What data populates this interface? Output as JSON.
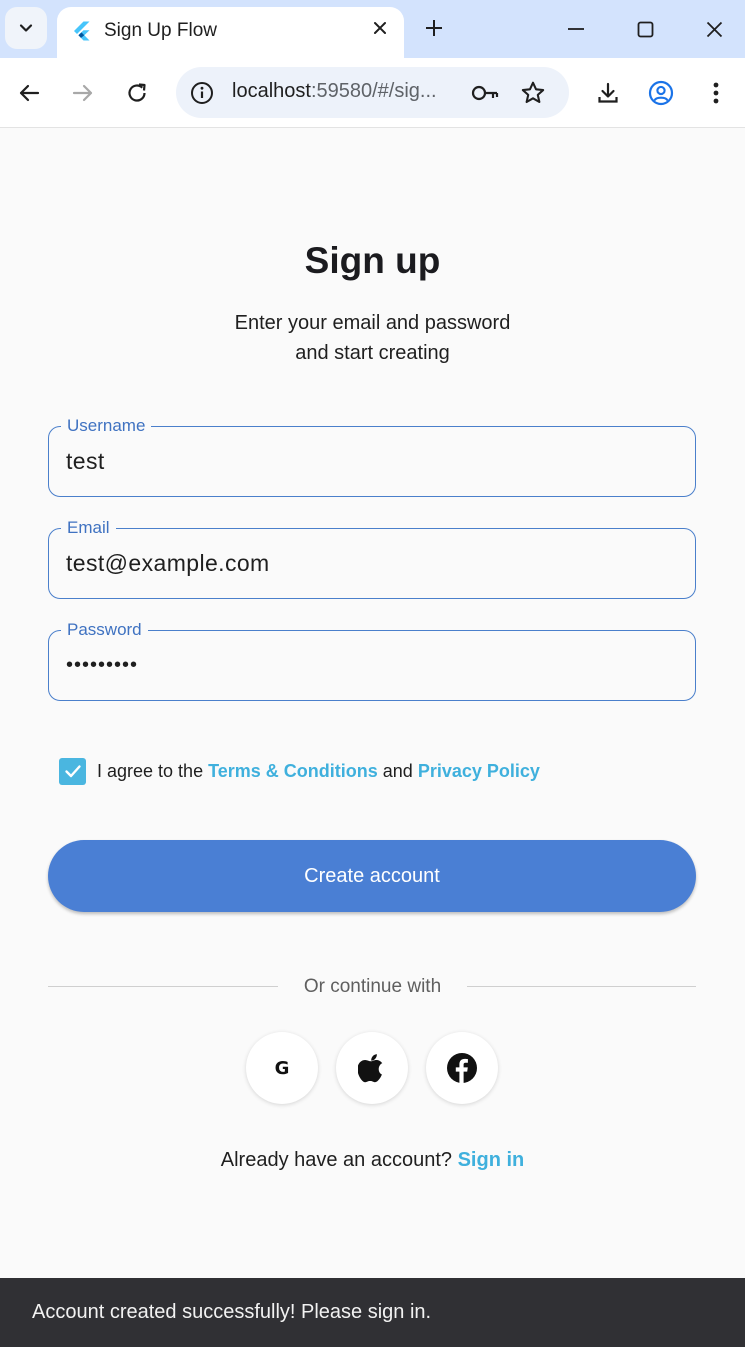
{
  "browser": {
    "tab_title": "Sign Up Flow",
    "url_host": "localhost",
    "url_rest": ":59580/#/sig..."
  },
  "page": {
    "title": "Sign up",
    "subtitle_line1": "Enter your email and password",
    "subtitle_line2": "and start creating"
  },
  "form": {
    "username_label": "Username",
    "username_value": "test",
    "email_label": "Email",
    "email_value": "test@example.com",
    "password_label": "Password",
    "password_value": "•••••••••",
    "agree_checked": true,
    "agree_prefix": "I agree to the ",
    "terms_link": "Terms & Conditions",
    "agree_and": " and ",
    "privacy_link": "Privacy Policy",
    "create_button": "Create account"
  },
  "social": {
    "divider_text": "Or continue with",
    "google_letter": "G",
    "icons": [
      "google-icon",
      "apple-icon",
      "facebook-icon"
    ]
  },
  "signin": {
    "prompt": "Already have an account? ",
    "link": "Sign in"
  },
  "snackbar": {
    "message": "Account created successfully! Please sign in."
  },
  "colors": {
    "primary": "#4a7fd4",
    "link": "#3fb0dd",
    "checkbox": "#4ab6e0",
    "field_border": "#4a7fcb",
    "snackbar_bg": "#303034",
    "tabstrip_bg": "#d3e3fd"
  }
}
